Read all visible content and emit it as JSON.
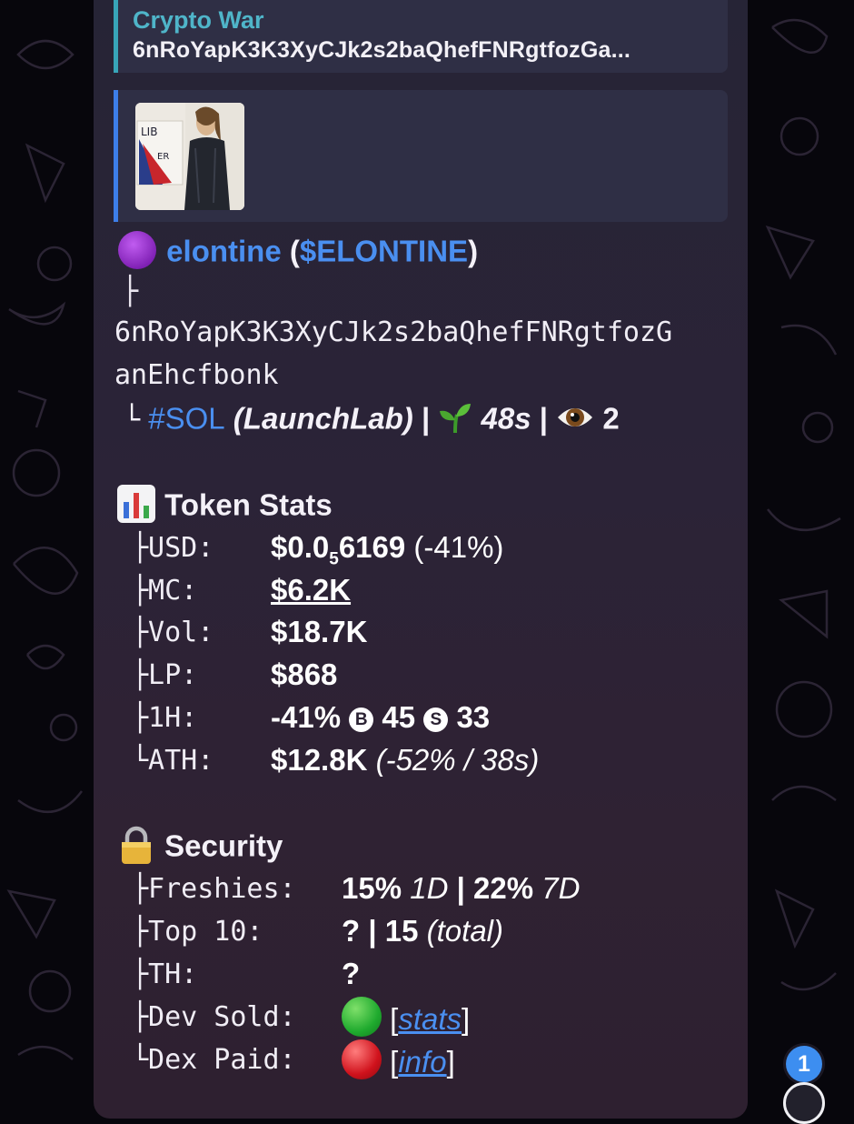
{
  "reply": {
    "title": "Crypto War",
    "text": "6nRoYapK3K3XyCJk2s2baQhefFNRgtfozGa..."
  },
  "token": {
    "name": "elontine",
    "open_paren": "(",
    "ticker": "$ELONTINE",
    "close_paren": ")",
    "tree_branch": "├",
    "address_line1": "6nRoYapK3K3XyCJk2s2baQhefFNRgtfozG",
    "address_line2": "anEhcfbonk",
    "tree_end": "└",
    "chain_tag": "#SOL",
    "platform": "(LaunchLab)",
    "separator1": "|",
    "age": "48s",
    "separator2": "|",
    "views": "2"
  },
  "stats": {
    "heading": "Token Stats",
    "usd_label": "├USD:",
    "usd_value_prefix": "$0.0",
    "usd_value_sub": "5",
    "usd_value_suffix": "6169",
    "usd_change": "(-41%)",
    "mc_label": "├MC:",
    "mc_value": "$6.2K",
    "vol_label": "├Vol:",
    "vol_value": "$18.7K",
    "lp_label": "├LP:",
    "lp_value": "$868",
    "h1_label": "├1H:",
    "h1_change": "-41%",
    "buy_badge": "B",
    "buys": "45",
    "sell_badge": "S",
    "sells": "33",
    "ath_label": "└ATH:",
    "ath_value": "$12.8K",
    "ath_detail": "(-52% / 38s)"
  },
  "security": {
    "heading": "Security",
    "freshies_label": "├Freshies:",
    "freshies_1d": "15%",
    "freshies_1d_unit": "1D",
    "freshies_sep": "|",
    "freshies_7d": "22%",
    "freshies_7d_unit": "7D",
    "top10_label": "├Top 10:",
    "top10_q": "?",
    "top10_sep": "|",
    "top10_total": "15",
    "top10_total_label": "(total)",
    "th_label": "├TH:",
    "th_value": "?",
    "dev_sold_label": "├Dev Sold:",
    "dev_sold_status_color": "#1faa2e",
    "dev_sold_open": "[",
    "dev_sold_link": "stats",
    "dev_sold_close": "]",
    "dex_paid_label": "└Dex Paid:",
    "dex_paid_status_color": "#d0121c",
    "dex_paid_open": "[",
    "dex_paid_link": "info",
    "dex_paid_close": "]"
  },
  "scroll_badge": {
    "count": "1"
  },
  "icons": {
    "token_dot": "purple-circle-icon",
    "chart": "bar-chart-icon",
    "sprout": "seedling-icon",
    "eye": "eye-icon",
    "lock": "lock-icon"
  },
  "colors": {
    "accent": "#4a8ff0",
    "reply_bar": "#38a5b8",
    "purple_dot": "#a437d6"
  }
}
